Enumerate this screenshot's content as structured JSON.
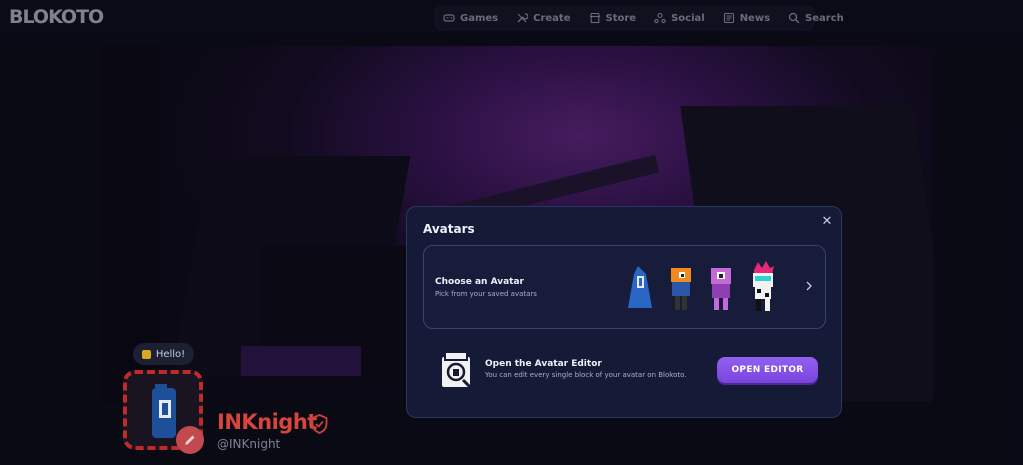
{
  "app": {
    "logo": "BLOKOTO"
  },
  "nav": {
    "items": [
      {
        "label": "Games",
        "icon": "gamepad-icon"
      },
      {
        "label": "Create",
        "icon": "wrench-icon"
      },
      {
        "label": "Store",
        "icon": "store-icon"
      },
      {
        "label": "Social",
        "icon": "social-icon"
      },
      {
        "label": "News",
        "icon": "newspaper-icon"
      },
      {
        "label": "Search",
        "icon": "search-icon"
      }
    ]
  },
  "profile": {
    "greeting": "Hello!",
    "display_name": "INKnight",
    "handle": "@INKnight"
  },
  "modal": {
    "title": "Avatars",
    "choose": {
      "title": "Choose an Avatar",
      "subtitle": "Pick from your saved avatars"
    },
    "editor": {
      "title": "Open the Avatar Editor",
      "subtitle": "You can edit every single block of your avatar on Blokoto.",
      "button": "OPEN EDITOR"
    }
  },
  "colors": {
    "accent": "#7a44dc",
    "username": "#d9453d",
    "modal_bg": "#151a36",
    "hero_purple": "#7a2ea0"
  }
}
